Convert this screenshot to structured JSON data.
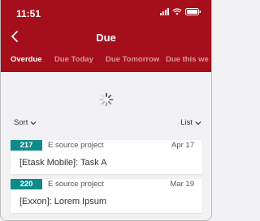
{
  "status_bar": {
    "time": "11:51"
  },
  "nav": {
    "title": "Due"
  },
  "tabs": [
    {
      "label": "Overdue",
      "active": true
    },
    {
      "label": "Due Today",
      "active": false
    },
    {
      "label": "Due Tomorrow",
      "active": false
    },
    {
      "label": "Due this we",
      "active": false
    }
  ],
  "controls": {
    "sort_label": "Sort",
    "view_label": "List"
  },
  "tasks": [
    {
      "id": "217",
      "project": "E source project",
      "date": "Apr 17",
      "title": "[Etask Mobile]: Task A"
    },
    {
      "id": "220",
      "project": "E source project",
      "date": "Mar 19",
      "title": "[Exxon]: Lorem Ipsum"
    }
  ],
  "colors": {
    "header": "#a50f1c",
    "id_badge": "#0f8a8c",
    "background": "#f2f2f4"
  },
  "icons": {
    "back": "chevron-left-icon",
    "sort": "chevron-down-icon",
    "view": "chevron-down-icon",
    "loading": "spinner-icon"
  }
}
